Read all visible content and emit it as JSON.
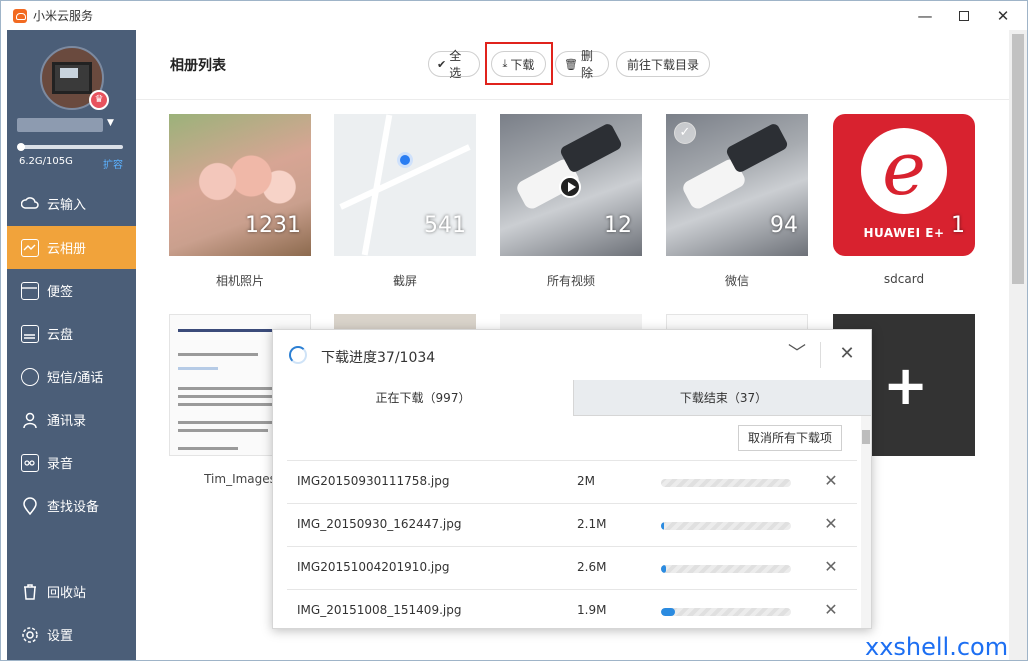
{
  "window": {
    "title": "小米云服务",
    "min": "—",
    "close": "✕"
  },
  "sidebar": {
    "badge_icon": "crown-icon",
    "storage": {
      "text": "6.2G/105G",
      "fraction_used": 0.06,
      "expand": "扩容"
    },
    "items": [
      {
        "label": "云输入",
        "icon": "cloud-input-icon"
      },
      {
        "label": "云相册",
        "icon": "album-icon",
        "active": true
      },
      {
        "label": "便签",
        "icon": "note-icon"
      },
      {
        "label": "云盘",
        "icon": "drive-icon"
      },
      {
        "label": "短信/通话",
        "icon": "message-icon"
      },
      {
        "label": "通讯录",
        "icon": "contacts-icon"
      },
      {
        "label": "录音",
        "icon": "recorder-icon"
      },
      {
        "label": "查找设备",
        "icon": "locate-device-icon"
      },
      {
        "label": "回收站",
        "icon": "trash-icon"
      },
      {
        "label": "设置",
        "icon": "settings-icon"
      }
    ],
    "colors": {
      "background": "#4b5e78",
      "active": "#f1a33b"
    }
  },
  "header": {
    "title": "相册列表",
    "buttons": {
      "select_all": "全选",
      "download": "下载",
      "delete": "删除",
      "open_dir": "前往下载目录"
    }
  },
  "albums": [
    {
      "name": "相机照片",
      "count": "1231"
    },
    {
      "name": "截屏",
      "count": "541"
    },
    {
      "name": "所有视频",
      "count": "12"
    },
    {
      "name": "微信",
      "count": "94"
    },
    {
      "name": "sdcard",
      "count": "1",
      "brand": "HUAWEI E+"
    },
    {
      "name": "Tim_Images"
    }
  ],
  "download_panel": {
    "title": "下载进度37/1034",
    "collapse": "﹀",
    "close": "✕",
    "tabs": {
      "active": "正在下载（997）",
      "done": "下载结束（37）"
    },
    "cancel_all": "取消所有下载项",
    "rows": [
      {
        "file": "IMG20150930111758.jpg",
        "size": "2M",
        "progress": 0.0
      },
      {
        "file": "IMG_20150930_162447.jpg",
        "size": "2.1M",
        "progress": 0.02
      },
      {
        "file": "IMG20151004201910.jpg",
        "size": "2.6M",
        "progress": 0.04
      },
      {
        "file": "IMG_20151008_151409.jpg",
        "size": "1.9M",
        "progress": 0.11
      }
    ],
    "accent": "#2b8be0"
  },
  "watermark": "xxshell.com"
}
